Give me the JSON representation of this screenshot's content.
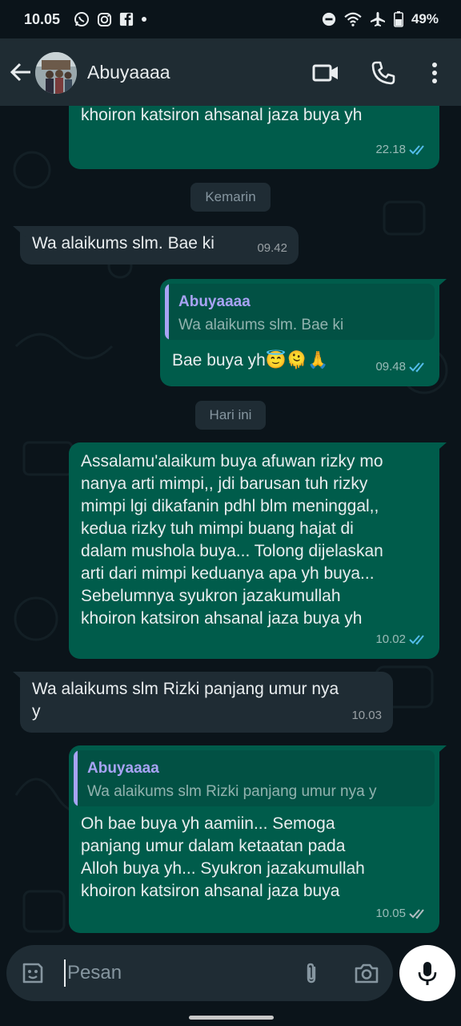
{
  "status_bar": {
    "time": "10.05",
    "battery": "49%",
    "left_icons": [
      "whatsapp-icon",
      "instagram-icon",
      "facebook-icon",
      "notification-dot-icon"
    ],
    "right_icons": [
      "do-not-disturb-icon",
      "wifi-icon",
      "airplane-icon",
      "battery-icon"
    ]
  },
  "header": {
    "contact_name": "Abuyaaaa",
    "icons": [
      "back-arrow-icon",
      "video-call-icon",
      "voice-call-icon",
      "more-options-icon"
    ]
  },
  "messages": [
    {
      "direction": "out",
      "text": "Sebelumnya syukron jazakumullah\nkhoiron katsiron ahsanal jaza buya yh",
      "time": "22.18",
      "status": "read"
    },
    {
      "type": "date",
      "label": "Kemarin"
    },
    {
      "direction": "in",
      "text": "Wa alaikums slm. Bae ki",
      "time": "09.42"
    },
    {
      "direction": "out",
      "quote": {
        "author": "Abuyaaaa",
        "text": "Wa alaikums slm. Bae ki"
      },
      "text": "Bae buya yh😇🫠🙏",
      "time": "09.48",
      "status": "read"
    },
    {
      "type": "date",
      "label": "Hari ini"
    },
    {
      "direction": "out",
      "text": "Assalamu'alaikum buya afuwan rizky mo\nnanya arti mimpi,, jdi barusan tuh rizky\nmimpi lgi dikafanin pdhl blm meninggal,,\nkedua rizky tuh mimpi buang hajat di\ndalam mushola buya... Tolong dijelaskan\narti dari mimpi keduanya apa yh buya...\nSebelumnya syukron jazakumullah\nkhoiron katsiron ahsanal jaza buya yh",
      "time": "10.02",
      "status": "read"
    },
    {
      "direction": "in",
      "text": "Wa alaikums slm Rizki panjang umur nya\ny",
      "time": "10.03"
    },
    {
      "direction": "out",
      "quote": {
        "author": "Abuyaaaa",
        "text": "Wa alaikums slm Rizki panjang umur nya y"
      },
      "text": "Oh bae buya yh aamiin... Semoga\npanjang umur dalam ketaatan pada\nAlloh buya yh... Syukron jazakumullah\nkhoiron katsiron ahsanal jaza buya",
      "time": "10.05",
      "status": "delivered"
    }
  ],
  "input": {
    "placeholder": "Pesan",
    "icons": [
      "sticker-icon",
      "attach-icon",
      "camera-icon",
      "microphone-icon"
    ]
  },
  "colors": {
    "background": "#0b141a",
    "header": "#1f2c33",
    "outgoing_bubble": "#005c4b",
    "incoming_bubble": "#1f2c34",
    "read_tick": "#53bdeb",
    "quote_accent": "#a8a3f4"
  }
}
